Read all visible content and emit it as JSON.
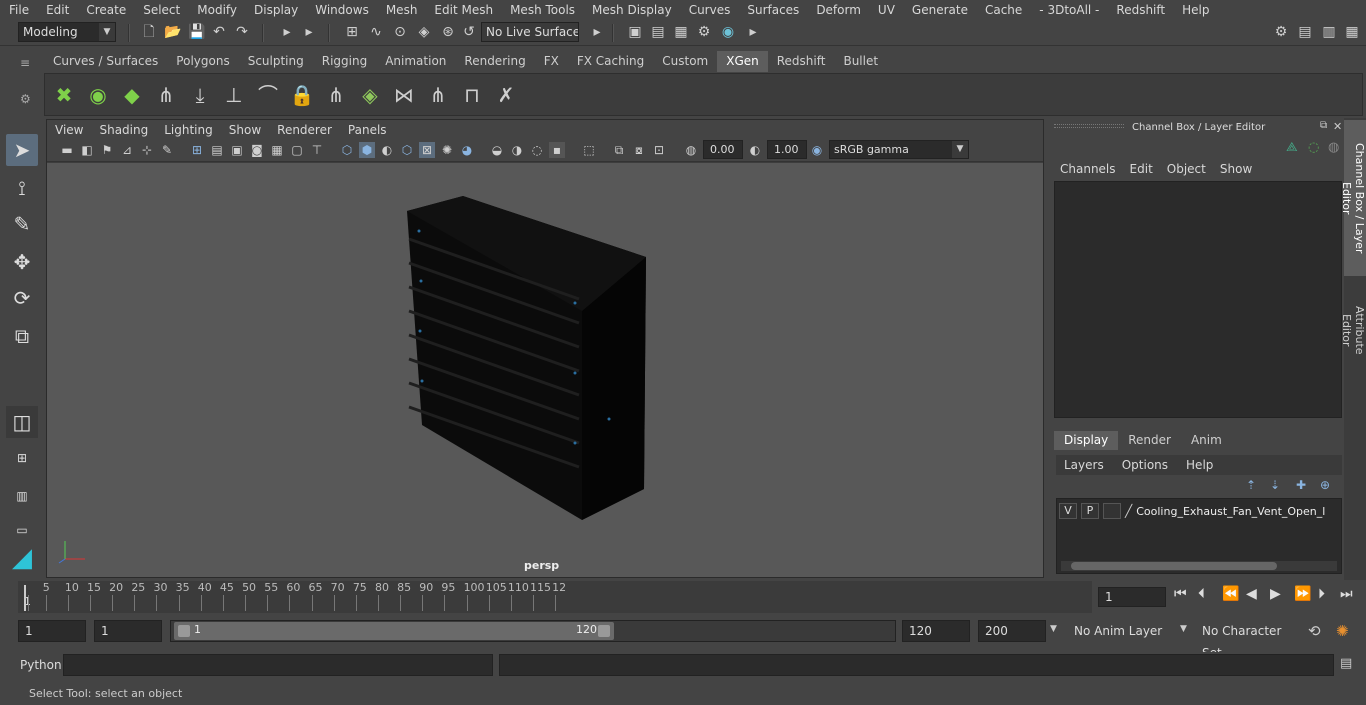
{
  "menubar": [
    "File",
    "Edit",
    "Create",
    "Select",
    "Modify",
    "Display",
    "Windows",
    "Mesh",
    "Edit Mesh",
    "Mesh Tools",
    "Mesh Display",
    "Curves",
    "Surfaces",
    "Deform",
    "UV",
    "Generate",
    "Cache",
    "- 3DtoAll -",
    "Redshift",
    "Help"
  ],
  "status": {
    "mode": "Modeling",
    "live_surface": "No Live Surface"
  },
  "shelf_tabs": [
    "Curves / Surfaces",
    "Polygons",
    "Sculpting",
    "Rigging",
    "Animation",
    "Rendering",
    "FX",
    "FX Caching",
    "Custom",
    "XGen",
    "Redshift",
    "Bullet"
  ],
  "active_shelf": "XGen",
  "viewport": {
    "menu": [
      "View",
      "Shading",
      "Lighting",
      "Show",
      "Renderer",
      "Panels"
    ],
    "exposure": "0.00",
    "gamma": "1.00",
    "colorspace": "sRGB gamma",
    "camera": "persp"
  },
  "channel_box": {
    "title": "Channel Box / Layer Editor",
    "menu": [
      "Channels",
      "Edit",
      "Object",
      "Show"
    ]
  },
  "layer_editor": {
    "tabs": [
      "Display",
      "Render",
      "Anim"
    ],
    "active_tab": "Display",
    "menu": [
      "Layers",
      "Options",
      "Help"
    ],
    "layer": {
      "v": "V",
      "p": "P",
      "name": "Cooling_Exhaust_Fan_Vent_Open_layer"
    }
  },
  "side_tabs": [
    "Channel Box / Layer Editor",
    "Attribute Editor"
  ],
  "timeline": {
    "labels": [
      "5",
      "10",
      "15",
      "20",
      "25",
      "30",
      "35",
      "40",
      "45",
      "50",
      "55",
      "60",
      "65",
      "70",
      "75",
      "80",
      "85",
      "90",
      "95",
      "100",
      "105",
      "110",
      "115",
      "12"
    ],
    "start_marker": "1",
    "current_frame": "1"
  },
  "range": {
    "start": "1",
    "playback_start": "1",
    "bar_start": "1",
    "bar_end": "120",
    "playback_end": "120",
    "end": "200",
    "anim_layer": "No Anim Layer",
    "char_set": "No Character Set"
  },
  "command": {
    "lang": "Python"
  },
  "help": "Select Tool: select an object"
}
